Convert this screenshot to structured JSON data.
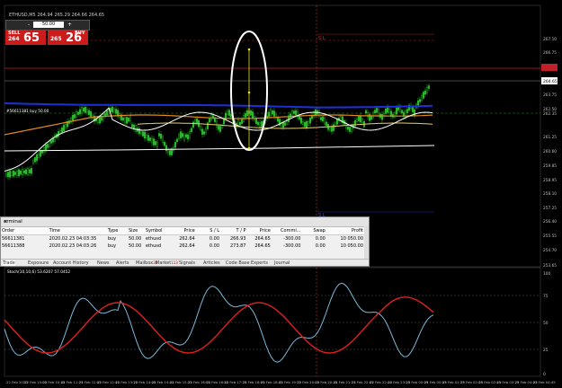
{
  "window": {
    "symbol_label": "ETHUSD,M5",
    "title_info": "ETHUSD,M5  264.94 265.29 264.66 264.65"
  },
  "trade_panel": {
    "sell_label": "SELL",
    "buy_label": "BUY",
    "lot_value": "50.00",
    "sell_price_small": "264",
    "sell_price_big": "65",
    "buy_price_small": "265",
    "buy_price_big": "26",
    "minus": "-",
    "plus": "+"
  },
  "chart": {
    "price_axis": [
      "267.10",
      "266.75",
      "265.90",
      "264.65",
      "263.75",
      "262.50",
      "262.35",
      "261.25",
      "260.60",
      "259.85",
      "258.95",
      "258.10",
      "257.25",
      "256.40",
      "255.55",
      "254.70",
      "253.65"
    ],
    "current_price": "264.65",
    "current_price_marker": "264.65",
    "position_label": "#56611381 buy 50.00",
    "sl_top_label": "S.L",
    "sl_bottom_label": "S.L",
    "time_axis": [
      "22 Feb 2020",
      "22 Feb 10:05",
      "22 Feb 10:45",
      "22 Feb 11:25",
      "22 Feb 12:05",
      "22 Feb 12:45",
      "22 Feb 13:25",
      "22 Feb 14:05",
      "22 Feb 14:45",
      "22 Feb 15:25",
      "22 Feb 16:05",
      "22 Feb 16:45",
      "22 Feb 17:25",
      "22 Feb 18:05",
      "22 Feb 18:45",
      "22 Feb 19:25",
      "22 Feb 20:05",
      "22 Feb 20:45",
      "22 Feb 21:25",
      "22 Feb 22:05",
      "22 Feb 22:45",
      "22 Feb 23:25",
      "23 Feb 00:05",
      "23 Feb 00:45",
      "23 Feb 01:25",
      "23 Feb 02:05",
      "23 Feb 02:45",
      "23 Feb 03:25",
      "23 Feb 04:05",
      "23 Feb 04:45"
    ]
  },
  "oscillator": {
    "label": "Stoch(10,10,6) 53.6207 57.0452",
    "levels": [
      "100",
      "75",
      "50",
      "25",
      "0"
    ]
  },
  "terminal": {
    "title": "erminal",
    "close": "×",
    "headers": [
      "Order",
      "Time",
      "Type",
      "Size",
      "Symbol",
      "Price",
      "S / L",
      "T / P",
      "Price",
      "Commi...",
      "Swap",
      "Profit"
    ],
    "rows": [
      [
        "56611381",
        "2020.02.23 04:03:35",
        "buy",
        "50.00",
        "ethusd",
        "262.64",
        "0.00",
        "266.93",
        "264.65",
        "-300.00",
        "0.00",
        "10 050.00"
      ],
      [
        "56611388",
        "2020.02.23 04:03:26",
        "buy",
        "50.00",
        "ethusd",
        "262.64",
        "0.00",
        "273.87",
        "264.65",
        "-300.00",
        "0.00",
        "10 050.00"
      ]
    ],
    "tabs": [
      "Trade",
      "Exposure",
      "Account History",
      "News",
      "Alerts",
      "Mailbox",
      "Market",
      "Signals",
      "Articles",
      "Code Base",
      "Experts",
      "Journal"
    ],
    "mailbox_badge": "38",
    "market_badge": "113"
  }
}
